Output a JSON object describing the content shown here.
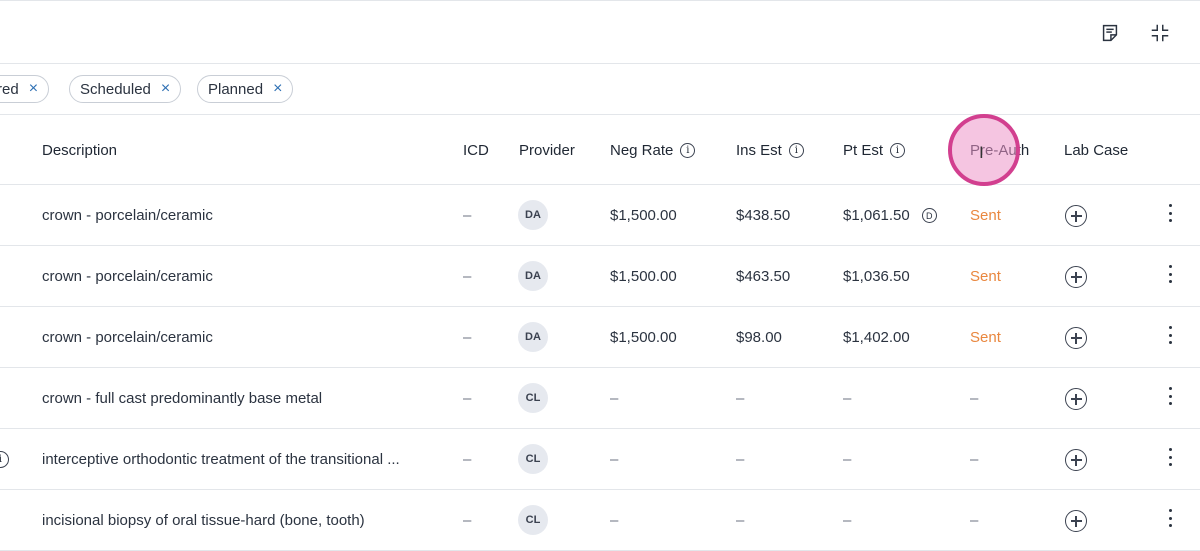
{
  "toolbar": {
    "notes_icon": "notes-icon",
    "collapse_icon": "collapse-icon"
  },
  "filters": [
    {
      "label": "red"
    },
    {
      "label": "Scheduled"
    },
    {
      "label": "Planned"
    }
  ],
  "filter_close_glyph": "×",
  "columns": {
    "description": "Description",
    "icd": "ICD",
    "provider": "Provider",
    "neg_rate": "Neg Rate",
    "ins_est": "Ins Est",
    "pt_est": "Pt Est",
    "pre_auth": "Pre-Auth",
    "lab_case": "Lab Case",
    "info_glyph": "i"
  },
  "rows": [
    {
      "description": "crown - porcelain/ceramic",
      "icd": "–",
      "provider": "DA",
      "neg_rate": "$1,500.00",
      "ins_est": "$438.50",
      "pt_est": "$1,061.50",
      "pt_badge": "D",
      "pre_auth": "Sent"
    },
    {
      "description": "crown - porcelain/ceramic",
      "icd": "–",
      "provider": "DA",
      "neg_rate": "$1,500.00",
      "ins_est": "$463.50",
      "pt_est": "$1,036.50",
      "pre_auth": "Sent"
    },
    {
      "description": "crown - porcelain/ceramic",
      "icd": "–",
      "provider": "DA",
      "neg_rate": "$1,500.00",
      "ins_est": "$98.00",
      "pt_est": "$1,402.00",
      "pre_auth": "Sent"
    },
    {
      "description": "crown - full cast predominantly base metal",
      "icd": "–",
      "provider": "CL",
      "neg_rate": "–",
      "ins_est": "–",
      "pt_est": "–",
      "pre_auth": "–"
    },
    {
      "description": "interceptive orthodontic treatment of the transitional ...",
      "icd": "–",
      "provider": "CL",
      "neg_rate": "–",
      "ins_est": "–",
      "pt_est": "–",
      "pre_auth": "–",
      "left_info": "i"
    },
    {
      "description": "incisional biopsy of oral tissue-hard (bone, tooth)",
      "icd": "–",
      "provider": "CL",
      "neg_rate": "–",
      "ins_est": "–",
      "pt_est": "–",
      "pre_auth": "–"
    }
  ],
  "colors": {
    "accent": "#2d6fb3",
    "sent": "#e9873f",
    "highlight_ring": "#d23f8f",
    "highlight_fill": "#f1b6d8"
  },
  "cursor_glyph": "I"
}
